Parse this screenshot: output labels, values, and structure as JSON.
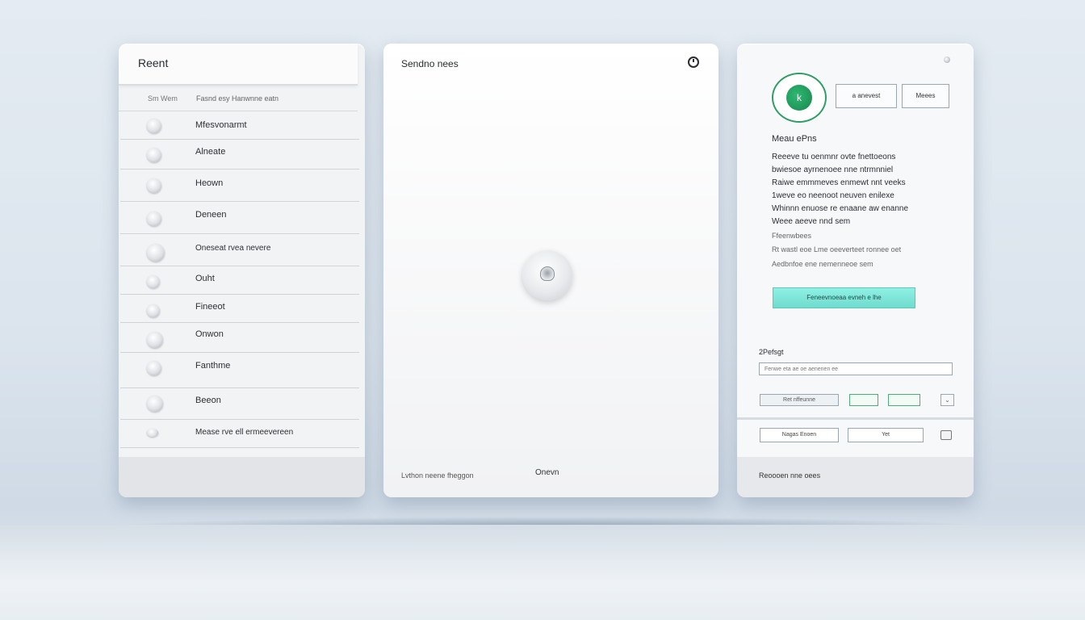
{
  "left_panel": {
    "title": "Reent",
    "filter_a": "Sm  Wem",
    "filter_b": "Fasnd esy  Hanwnne eatn",
    "items": [
      {
        "label": "Mfesvonarmt"
      },
      {
        "label": "Alneate"
      },
      {
        "label": "Heown"
      },
      {
        "label": "Deneen"
      },
      {
        "label": "Oneseat rvea nevere"
      },
      {
        "label": "Ouht"
      },
      {
        "label": "Fineeot"
      },
      {
        "label": "Onwon"
      },
      {
        "label": "Fanthme"
      },
      {
        "label": "Beeon"
      },
      {
        "label": "Mease rve ell ermeevereen"
      }
    ]
  },
  "center_panel": {
    "title": "Sendno nees",
    "footer_left": "Lvthon neene fheggon",
    "footer_right": "Onevn"
  },
  "right_panel": {
    "avatar_initial": "k",
    "button_a": "a anevest",
    "button_b": "Meees",
    "name": "Meau ePns",
    "paragraph": [
      "Reeeve tu oenmnr ovte fnettoeons",
      "bwiesoe ayrnenoee nne ntrmnniel",
      "Raiwe emmmeves enmewt nnt veeks",
      "1weve eo neenoot neuven enilexe",
      "Whinnn enuose re enaane aw enanne",
      "Weee aeeve nnd sem"
    ],
    "meta_a": "Ffeenwbees",
    "meta_b": "Rt wastl eoe Lme oeeverteet ronnee oet",
    "meta_c": "Aedbnfoe ene nemenneoe sem",
    "cta_label": "Feneevnoeaa evneh e lhe",
    "field_label": "2Pefsgt",
    "field_value": "Fenwe eta ae oe aenenen ee",
    "chip_a": "Ret  nffeunne",
    "chip_b": "",
    "chip_c": "",
    "row2_a": "Nagas  Enoen",
    "row2_b": "   Yet",
    "footer_text": "Reoooen nne oees"
  }
}
